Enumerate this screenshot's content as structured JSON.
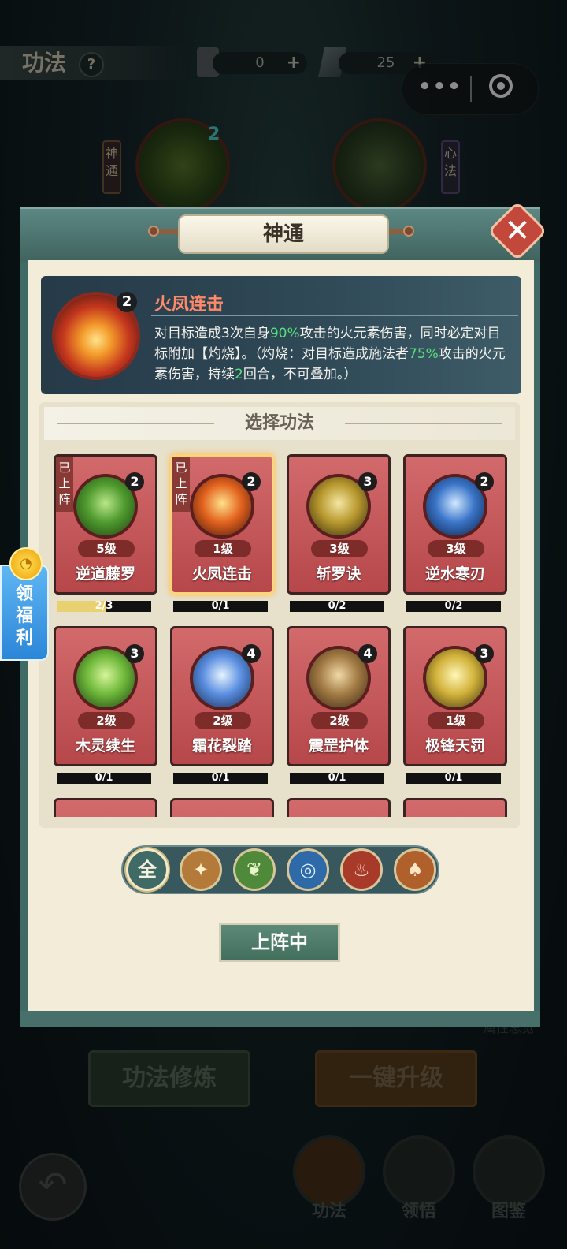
{
  "topbar": {
    "title": "功法",
    "help": "?",
    "res1_value": "0",
    "res2_value": "25",
    "plus": "+"
  },
  "capsule": {
    "more": "•••"
  },
  "top_tags": {
    "left": "神通",
    "right": "心法"
  },
  "top_orb_count": "2",
  "panel": {
    "title": "神通",
    "close": "✕"
  },
  "info": {
    "level": "2",
    "name": "火凤连击",
    "desc_parts": [
      "对目标造成3次自身",
      "90%",
      "攻击的火元素伤害，同时必定对目标附加【灼烧】。（灼烧：对目标造成施法者",
      "75%",
      "攻击的火元素伤害，持续",
      "2",
      "回合，不可叠加。）"
    ]
  },
  "select_title": "选择功法",
  "cards": [
    {
      "name": "逆道藤罗",
      "level": "5级",
      "num": "2",
      "progress": "2/3",
      "fill": 0.667,
      "badge": "已上阵",
      "selected": false,
      "colors": [
        "#b9e68a",
        "#4f9a2e",
        "#1c3e12"
      ]
    },
    {
      "name": "火凤连击",
      "level": "1级",
      "num": "2",
      "progress": "0/1",
      "fill": 0,
      "badge": "已上阵",
      "selected": true,
      "colors": [
        "#ffe08a",
        "#e2621e",
        "#3e140c"
      ]
    },
    {
      "name": "斩罗诀",
      "level": "3级",
      "num": "3",
      "progress": "0/2",
      "fill": 0,
      "badge": "",
      "selected": false,
      "colors": [
        "#f4e6a2",
        "#b8982e",
        "#2e2610"
      ]
    },
    {
      "name": "逆水寒刃",
      "level": "3级",
      "num": "2",
      "progress": "0/2",
      "fill": 0,
      "badge": "",
      "selected": false,
      "colors": [
        "#cfe8ff",
        "#3a74c8",
        "#0e1e3e"
      ]
    },
    {
      "name": "木灵续生",
      "level": "2级",
      "num": "3",
      "progress": "0/1",
      "fill": 0,
      "badge": "",
      "selected": false,
      "colors": [
        "#d6f59a",
        "#6eb83a",
        "#1c3a12"
      ]
    },
    {
      "name": "霜花裂踏",
      "level": "2级",
      "num": "4",
      "progress": "0/1",
      "fill": 0,
      "badge": "",
      "selected": false,
      "colors": [
        "#e6f3ff",
        "#5a8ee0",
        "#142a4e"
      ]
    },
    {
      "name": "震罡护体",
      "level": "2级",
      "num": "4",
      "progress": "0/1",
      "fill": 0,
      "badge": "",
      "selected": false,
      "colors": [
        "#f0d9a6",
        "#a27a44",
        "#3a2614"
      ]
    },
    {
      "name": "极锋天罚",
      "level": "1级",
      "num": "3",
      "progress": "0/1",
      "fill": 0,
      "badge": "",
      "selected": false,
      "colors": [
        "#fff6b8",
        "#d2b23a",
        "#3a3010"
      ]
    }
  ],
  "filters": [
    {
      "name": "filter-all-icon",
      "glyph": "全",
      "bg": "#3f6a66",
      "color": "#f4f0de"
    },
    {
      "name": "filter-metal-icon",
      "glyph": "✦",
      "bg": "#b37a3a",
      "color": "#fff0c8"
    },
    {
      "name": "filter-wood-icon",
      "glyph": "❦",
      "bg": "#4e8a3a",
      "color": "#e6f6c8"
    },
    {
      "name": "filter-water-icon",
      "glyph": "◎",
      "bg": "#2e6aa8",
      "color": "#d8ecff"
    },
    {
      "name": "filter-fire-icon",
      "glyph": "♨",
      "bg": "#a83a2a",
      "color": "#ffd6c4"
    },
    {
      "name": "filter-earth-icon",
      "glyph": "♠",
      "bg": "#b0602a",
      "color": "#ffe6c4"
    }
  ],
  "onboard_label": "上阵中",
  "bottom": {
    "train": "功法修炼",
    "upgrade": "一键升级",
    "back": "↶",
    "nav": [
      "功法",
      "领悟",
      "图鉴"
    ],
    "faint_text": "属性总览"
  },
  "welfare": {
    "label": "领\n福\n利",
    "coin": "◔"
  }
}
